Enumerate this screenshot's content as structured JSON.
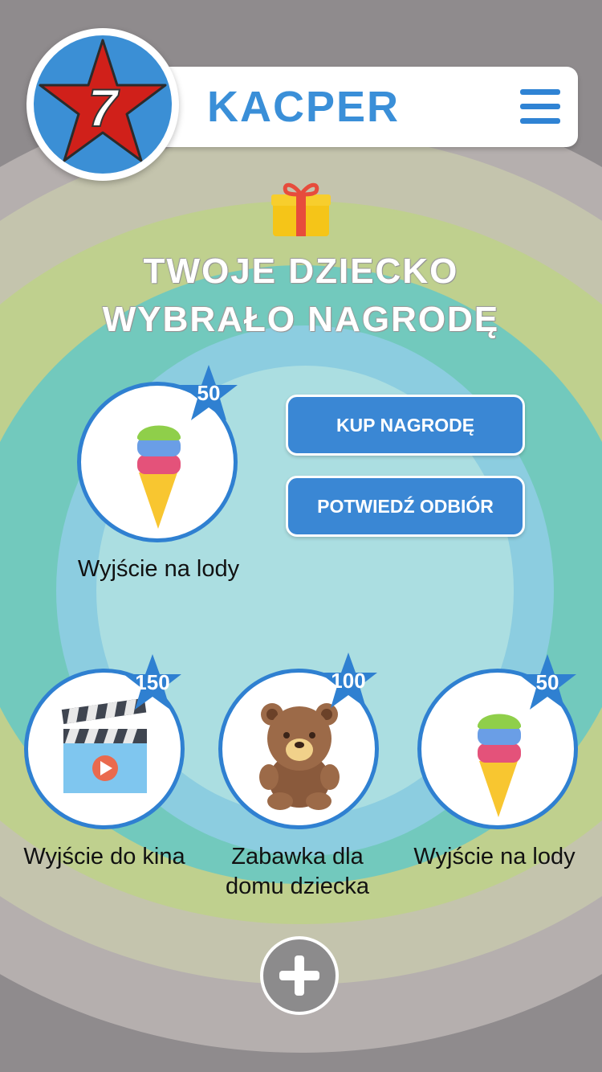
{
  "header": {
    "child_name": "KACPER",
    "level": "7",
    "menu_icon": "hamburger-menu-icon"
  },
  "headline": {
    "line1": "TWOJE DZIECKO",
    "line2": "WYBRAŁO NAGRODĘ"
  },
  "selected_reward": {
    "label": "Wyjście na lody",
    "points": "50",
    "icon": "ice-cream-icon"
  },
  "actions": {
    "buy": "KUP NAGRODĘ",
    "confirm": "POTWIEDŹ ODBIÓR"
  },
  "rewards": [
    {
      "label": "Wyjście do kina",
      "points": "150",
      "icon": "clapperboard-icon"
    },
    {
      "label": "Zabawka dla domu dziecka",
      "points": "100",
      "icon": "teddy-bear-icon"
    },
    {
      "label": "Wyjście na lody",
      "points": "50",
      "icon": "ice-cream-icon"
    }
  ],
  "footer": {
    "add_icon": "plus-icon"
  },
  "colors": {
    "accent": "#3a87d4",
    "star_red": "#d0201a",
    "background": "#8f8b8d"
  }
}
